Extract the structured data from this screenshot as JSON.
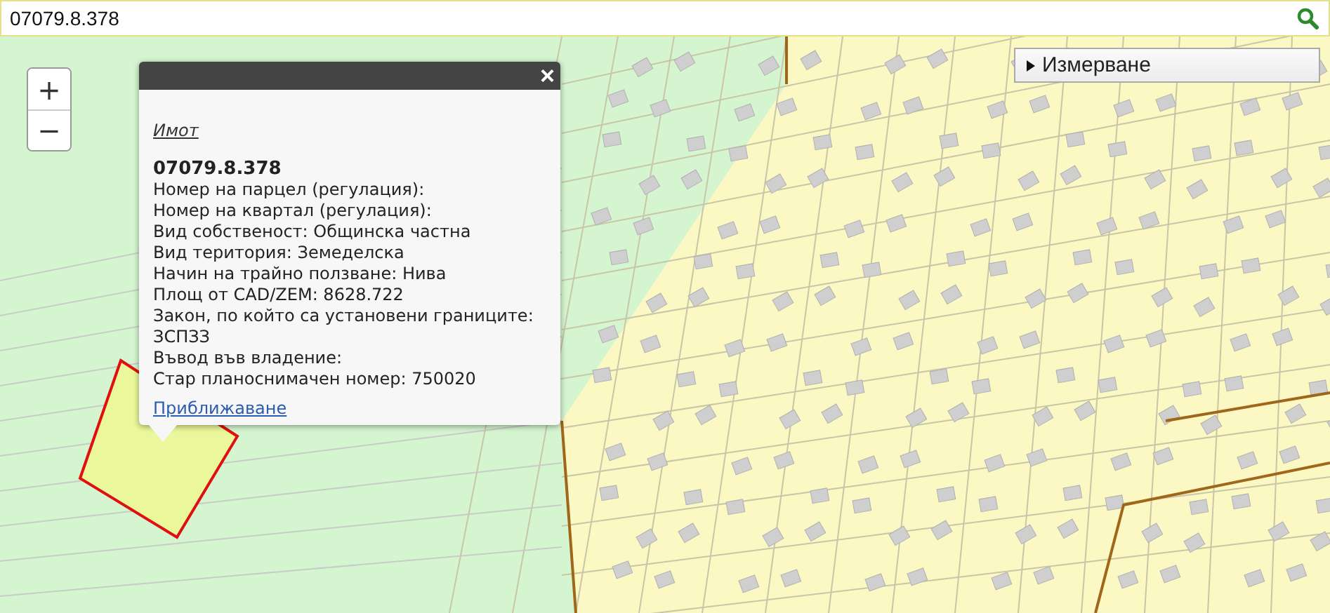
{
  "search": {
    "value": "07079.8.378"
  },
  "zoom_controls": [
    {
      "label": "+"
    },
    {
      "label": "−"
    }
  ],
  "measure_panel": {
    "label": "Измерване",
    "expanded": false
  },
  "popup": {
    "close": "×",
    "layer_link": "Имот",
    "title": "07079.8.378",
    "lines": [
      "Номер на парцел (регулация):",
      "Номер на квартал (регулация):",
      "Вид собственост: Общинска частна",
      "Вид територия: Земеделска",
      "Начин на трайно ползване: Нива",
      "Площ от CAD/ZEM: 8628.722",
      "Закон, по който са установени границите:",
      "ЗСПЗЗ",
      "Въвод във владение:",
      "Стар планоснимачен номер: 750020"
    ],
    "zoom_link": "Приближаване"
  }
}
